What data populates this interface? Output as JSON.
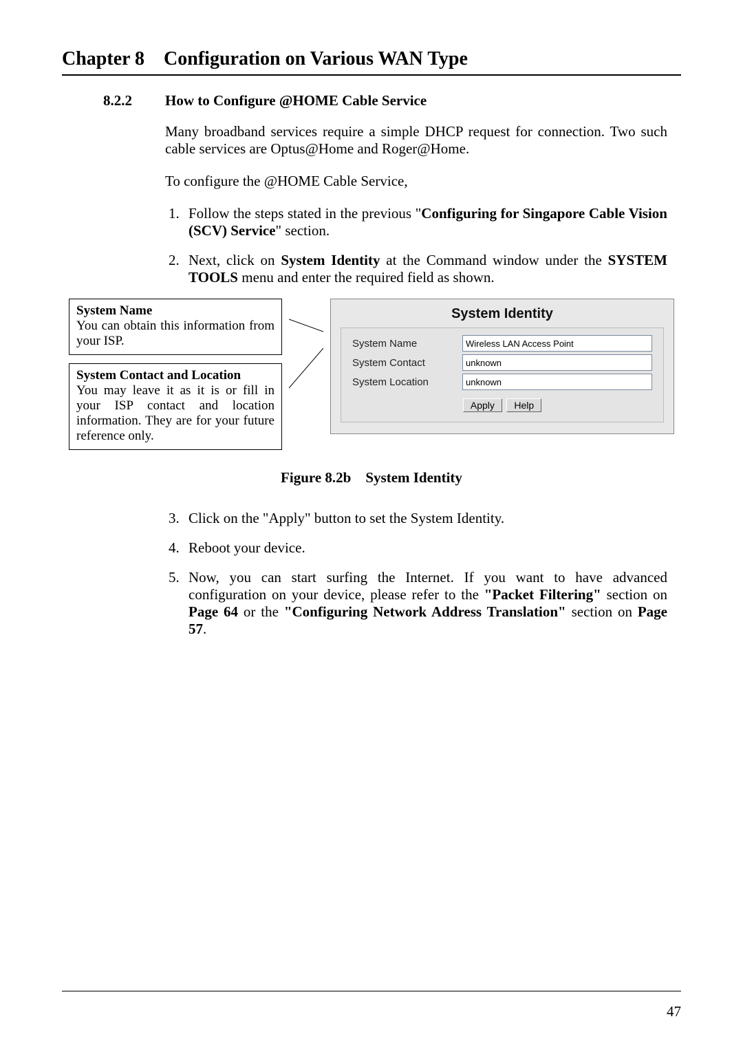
{
  "chapter": {
    "label": "Chapter 8",
    "title": "Configuration on Various WAN Type"
  },
  "section": {
    "number": "8.2.2",
    "title": "How to Configure @HOME Cable Service"
  },
  "paras": {
    "intro1": "Many broadband services require a simple DHCP request for connection. Two such cable services are Optus@Home and Roger@Home.",
    "intro2": "To configure the @HOME Cable Service,"
  },
  "steps": {
    "one_a": "Follow the steps stated in the previous \"",
    "one_bold": "Configuring for Singapore Cable Vision (SCV) Service",
    "one_b": "\" section.",
    "two_a": "Next, click on ",
    "two_bold1": "System Identity",
    "two_b": " at the Command window under the ",
    "two_bold2": "SYSTEM TOOLS",
    "two_c": " menu and enter the required field as shown.",
    "three": "Click on the \"Apply\" button to set the System Identity.",
    "four": "Reboot your device.",
    "five_a": "Now, you can start surfing the Internet. If you want to have advanced configuration on your device, please refer to the ",
    "five_bold1": "\"Packet Filtering\"",
    "five_b": " section on ",
    "five_bold2": "Page 64",
    "five_c": " or the ",
    "five_bold3": "\"Configuring Network Address Translation\"",
    "five_d": " section on ",
    "five_bold4": "Page 57",
    "five_e": "."
  },
  "callouts": {
    "sysname_title": "System Name",
    "sysname_body": "You can obtain this information from your ISP.",
    "syscontact_title": "System Contact and Location",
    "syscontact_body": "You may leave it as it is or fill in your ISP contact and location information. They are for your future reference only."
  },
  "screenshot": {
    "title": "System Identity",
    "fields": {
      "name_label": "System Name",
      "name_value": "Wireless LAN Access Point",
      "contact_label": "System Contact",
      "contact_value": "unknown",
      "location_label": "System Location",
      "location_value": "unknown"
    },
    "buttons": {
      "apply": "Apply",
      "help": "Help"
    }
  },
  "figure_caption": {
    "label": "Figure 8.2b",
    "title": "System Identity"
  },
  "page_number": "47"
}
